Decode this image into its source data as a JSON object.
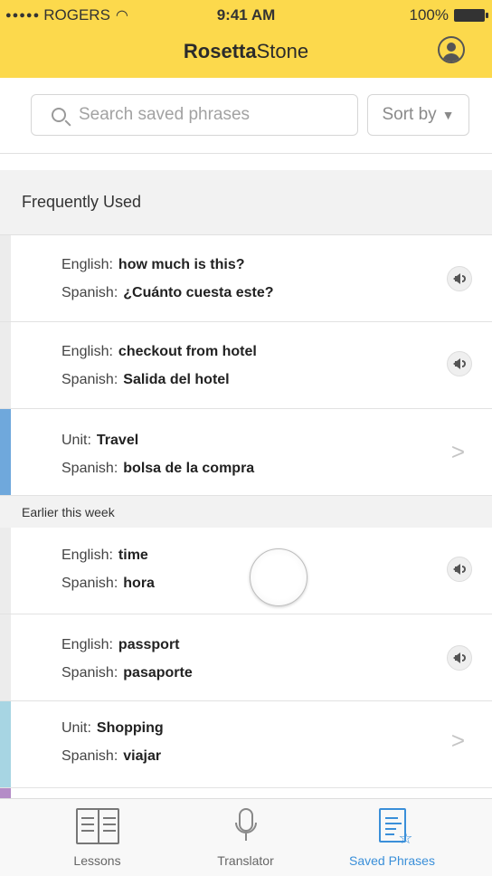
{
  "status_bar": {
    "carrier": "ROGERS",
    "time": "9:41 AM",
    "battery": "100%"
  },
  "header": {
    "brand_bold": "Rosetta",
    "brand_light": "Stone"
  },
  "search": {
    "placeholder": "Search saved phrases",
    "sort_label": "Sort by"
  },
  "sections": [
    {
      "title": "Frequently Used",
      "rows": [
        {
          "k1": "English:",
          "v1": "how much is this?",
          "k2": "Spanish:",
          "v2": "¿Cuánto cuesta este?",
          "action": "speaker-icon",
          "accent": "#ececec"
        },
        {
          "k1": "English:",
          "v1": "checkout from hotel",
          "k2": "Spanish:",
          "v2": "Salida del hotel",
          "action": "speaker-icon",
          "accent": "#ececec"
        },
        {
          "k1": "Unit:",
          "v1": "Travel",
          "k2": "Spanish:",
          "v2": "bolsa de la compra",
          "action": "chevron-right-icon",
          "accent": "#6fa8dc"
        }
      ]
    },
    {
      "title": "Earlier this week",
      "rows": [
        {
          "k1": "English:",
          "v1": "time",
          "k2": "Spanish:",
          "v2": "hora",
          "action": "speaker-icon",
          "accent": "#ececec"
        },
        {
          "k1": "English:",
          "v1": "passport",
          "k2": "Spanish:",
          "v2": "pasaporte",
          "action": "speaker-icon",
          "accent": "#ececec"
        },
        {
          "k1": "Unit:",
          "v1": "Shopping",
          "k2": "Spanish:",
          "v2": "viajar",
          "action": "chevron-right-icon",
          "accent": "#a7d5e3"
        }
      ]
    }
  ],
  "tabs": [
    {
      "label": "Lessons",
      "icon": "book-icon",
      "active": false
    },
    {
      "label": "Translator",
      "icon": "microphone-icon",
      "active": false
    },
    {
      "label": "Saved Phrases",
      "icon": "saved-phrases-icon",
      "active": true
    }
  ],
  "colors": {
    "header_bg": "#fcd94c",
    "active_tab": "#3a8fd9",
    "accent_travel": "#6fa8dc",
    "accent_shopping": "#a7d5e3",
    "accent_partial": "#b48cc7"
  }
}
